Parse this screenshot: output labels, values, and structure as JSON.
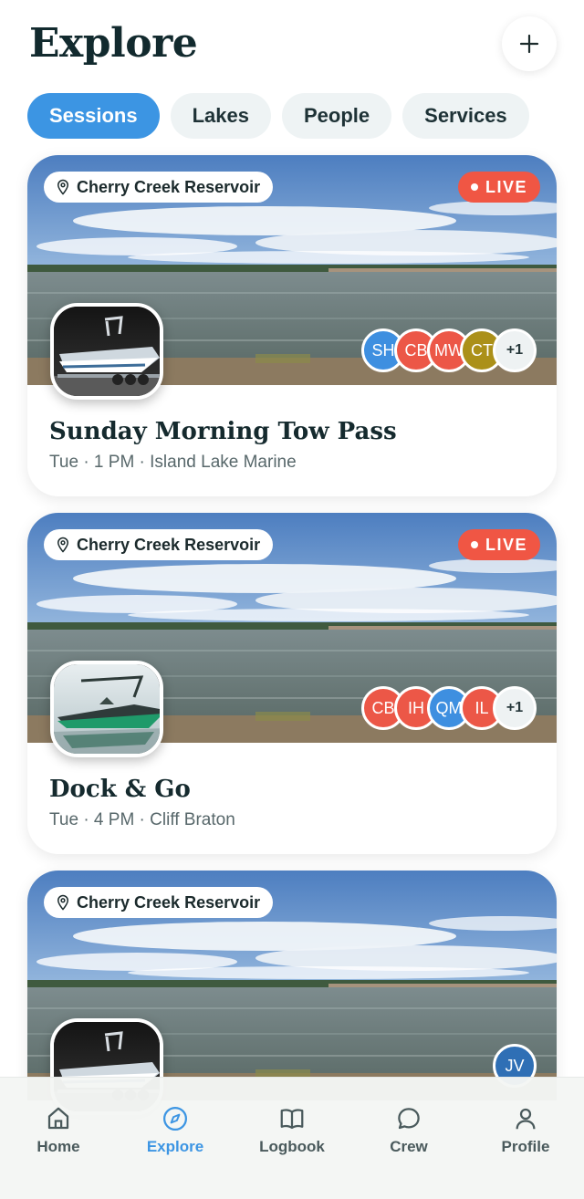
{
  "header": {
    "title": "Explore",
    "add_icon": "plus-icon"
  },
  "filters": [
    {
      "label": "Sessions",
      "active": true
    },
    {
      "label": "Lakes",
      "active": false
    },
    {
      "label": "People",
      "active": false
    },
    {
      "label": "Services",
      "active": false
    }
  ],
  "sessions": [
    {
      "location": "Cherry Creek Reservoir",
      "live_label": "LIVE",
      "title": "Sunday Morning Tow Pass",
      "subtitle": "Tue · 1 PM · Island Lake Marine",
      "boat": "silver-wakeboat",
      "participants": [
        {
          "initials": "SH",
          "color": "#3e8fe0"
        },
        {
          "initials": "CB",
          "color": "#ec5747"
        },
        {
          "initials": "MW",
          "color": "#ec5747"
        },
        {
          "initials": "CT",
          "color": "#ab9019"
        }
      ],
      "more": "+1"
    },
    {
      "location": "Cherry Creek Reservoir",
      "live_label": "LIVE",
      "title": "Dock & Go",
      "subtitle": "Tue · 4 PM · Cliff Braton",
      "boat": "green-wakeboat",
      "participants": [
        {
          "initials": "CB",
          "color": "#ec5747"
        },
        {
          "initials": "IH",
          "color": "#ec5747"
        },
        {
          "initials": "QM",
          "color": "#3e8fe0"
        },
        {
          "initials": "IL",
          "color": "#ec5747"
        }
      ],
      "more": "+1"
    },
    {
      "location": "Cherry Creek Reservoir",
      "boat": "silver-wakeboat",
      "participants": [
        {
          "initials": "JV",
          "color": "#2f6fb5"
        }
      ]
    }
  ],
  "tabbar": [
    {
      "label": "Home",
      "icon": "home-icon",
      "active": false
    },
    {
      "label": "Explore",
      "icon": "compass-icon",
      "active": true
    },
    {
      "label": "Logbook",
      "icon": "book-icon",
      "active": false
    },
    {
      "label": "Crew",
      "icon": "chat-bubble-icon",
      "active": false
    },
    {
      "label": "Profile",
      "icon": "person-icon",
      "active": false
    }
  ],
  "colors": {
    "accent": "#3c95e3",
    "live": "#f05644",
    "title": "#122a2e"
  }
}
